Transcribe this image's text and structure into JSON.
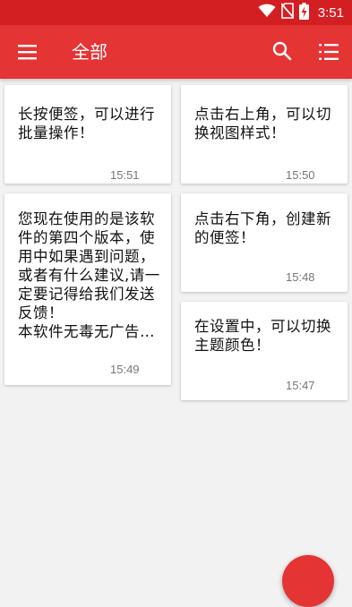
{
  "status_bar": {
    "time": "3:51",
    "icons": [
      "wifi-icon",
      "no-sim-icon",
      "battery-charging-icon"
    ]
  },
  "app_bar": {
    "title": "全部",
    "menu_icon": "menu-icon",
    "search_icon": "search-icon",
    "list_icon": "list-view-icon"
  },
  "notes": [
    {
      "text": "长按便签，可以进行批量操作！",
      "time": "15:51"
    },
    {
      "text": "点击右上角，可以切换视图样式！",
      "time": "15:50"
    },
    {
      "text": "您现在使用的是该软件的第四个版本，使用中如果遇到问题，或者有什么建议,请一定要记得给我们发送反馈！\n本软件无毒无广告…",
      "time": "15:49"
    },
    {
      "text": "点击右下角，创建新的便签！",
      "time": "15:48"
    },
    {
      "text": "在设置中，可以切换主题颜色！",
      "time": "15:47"
    }
  ],
  "fab": {
    "icon": "add-icon"
  },
  "colors": {
    "status_bar": "#d41f22",
    "app_bar": "#e53434",
    "background": "#f2f2f2",
    "card": "#ffffff",
    "time_text": "#777777"
  }
}
